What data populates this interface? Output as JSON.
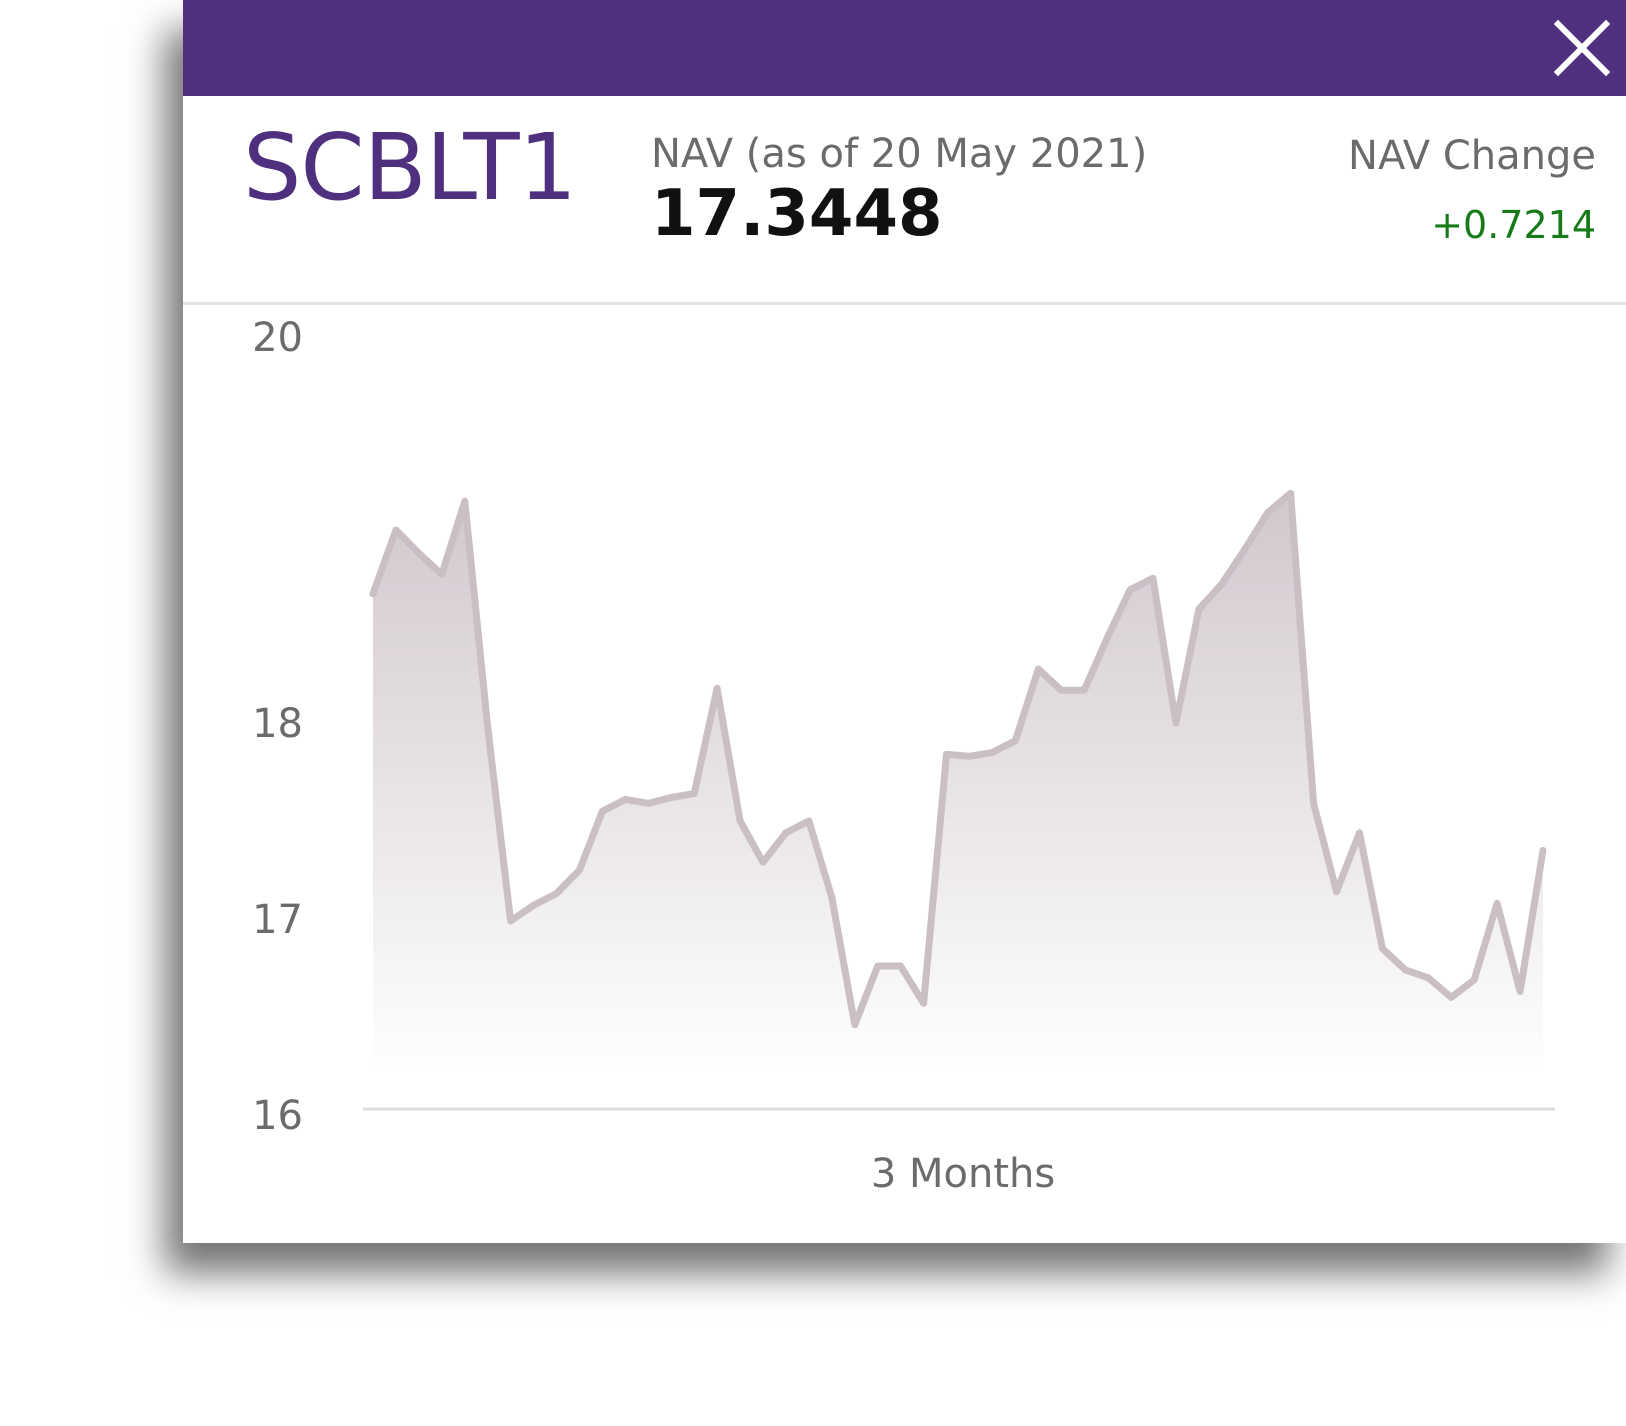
{
  "fund": {
    "ticker": "SCBLT1",
    "nav_label": "NAV (as of 20 May 2021)",
    "nav_value": "17.3448",
    "change_label": "NAV Change",
    "change_value": "+0.7214"
  },
  "colors": {
    "header": "#4e307f",
    "ticker": "#4e307f",
    "change_positive": "#167a19",
    "line": "#cbbfc6"
  },
  "icons": {
    "close": "close-icon"
  },
  "chart_data": {
    "type": "area",
    "xlabel": "3 Months",
    "ylabel": "",
    "y_ticks": [
      "20",
      "18",
      "17",
      "16"
    ],
    "y_tick_values": [
      20,
      18,
      17,
      16
    ],
    "y_scale": "piecewise",
    "grid": false,
    "series": [
      {
        "values": [
          18.67,
          19.0,
          18.88,
          18.77,
          19.15,
          17.98,
          16.99,
          17.07,
          17.13,
          17.25,
          17.55,
          17.61,
          17.59,
          17.62,
          17.64,
          18.18,
          17.5,
          17.29,
          17.44,
          17.5,
          17.11,
          16.46,
          16.76,
          16.76,
          16.57,
          17.84,
          17.83,
          17.85,
          17.91,
          18.28,
          18.17,
          18.17,
          18.44,
          18.69,
          18.75,
          18.0,
          18.59,
          18.72,
          18.9,
          19.09,
          19.19,
          17.59,
          17.14,
          17.44,
          16.85,
          16.74,
          16.7,
          16.6,
          16.69,
          17.08,
          16.63,
          17.35
        ]
      }
    ]
  }
}
